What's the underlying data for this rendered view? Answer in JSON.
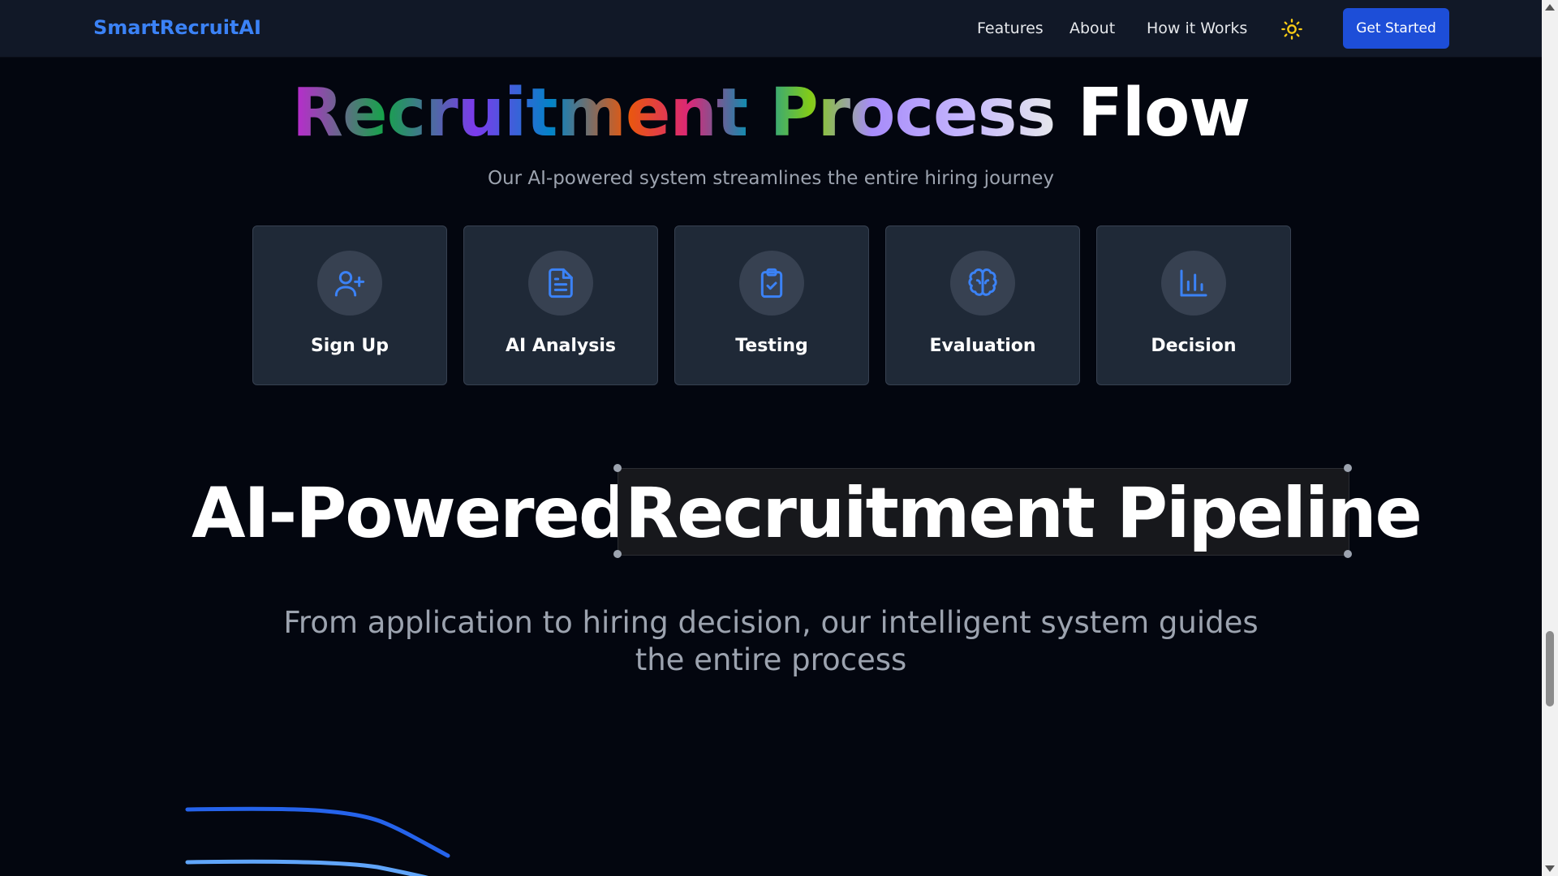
{
  "navbar": {
    "brand": "SmartRecruitAI",
    "links": [
      "Features",
      "About",
      "How it Works"
    ],
    "theme_icon": "sun-icon",
    "cta_label": "Get Started"
  },
  "flow": {
    "title_gradient": "Recruitment Process",
    "title_plain": "Flow",
    "subtitle": "Our AI-powered system streamlines the entire hiring journey",
    "steps": [
      {
        "label": "Sign Up",
        "icon": "user-plus-icon"
      },
      {
        "label": "AI Analysis",
        "icon": "document-icon"
      },
      {
        "label": "Testing",
        "icon": "clipboard-check-icon"
      },
      {
        "label": "Evaluation",
        "icon": "brain-icon"
      },
      {
        "label": "Decision",
        "icon": "bar-chart-icon"
      }
    ]
  },
  "pipeline": {
    "title_part1": "AI-Powered",
    "title_part2": "Recruitment Pipeline",
    "subtitle_line1": "From application to hiring decision, our intelligent system guides",
    "subtitle_line2": "the entire process"
  },
  "colors": {
    "accent": "#3b82f6",
    "cta": "#1d4ed8",
    "background": "#03060f",
    "card": "#1f2937",
    "sun": "#facc15"
  }
}
